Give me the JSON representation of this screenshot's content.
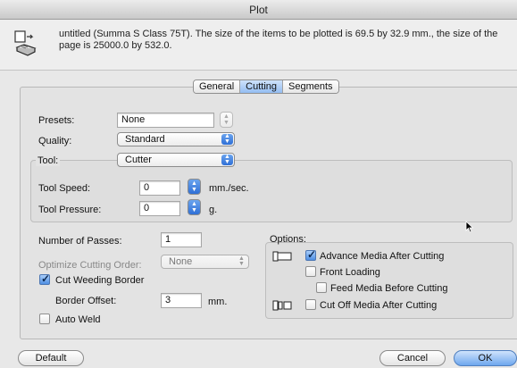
{
  "window": {
    "title": "Plot"
  },
  "info": {
    "message": "untitled (Summa S Class 75T). The size of the items to be plotted is 69.5 by 32.9 mm., the size of the page is 25000.0 by 532.0."
  },
  "tabs": [
    {
      "label": "General"
    },
    {
      "label": "Cutting"
    },
    {
      "label": "Segments"
    }
  ],
  "settings": {
    "presets_label": "Presets:",
    "presets_value": "None",
    "quality_label": "Quality:",
    "quality_value": "Standard",
    "tool_label": "Tool:",
    "tool_value": "Cutter"
  },
  "tool": {
    "speed_label": "Tool Speed:",
    "speed_value": "0",
    "speed_unit": "mm./sec.",
    "pressure_label": "Tool Pressure:",
    "pressure_value": "0",
    "pressure_unit": "g."
  },
  "passes": {
    "label": "Number of Passes:",
    "value": "1",
    "order_label": "Optimize Cutting Order:",
    "order_value": "None",
    "weeding_label": "Cut Weeding Border",
    "border_offset_label": "Border Offset:",
    "border_offset_value": "3",
    "border_offset_unit": "mm.",
    "auto_weld_label": "Auto Weld"
  },
  "options": {
    "title": "Options:",
    "advance_label": "Advance Media After Cutting",
    "front_label": "Front Loading",
    "feed_label": "Feed Media Before Cutting",
    "cutoff_label": "Cut Off Media After Cutting"
  },
  "buttons": {
    "default_label": "Default",
    "cancel_label": "Cancel",
    "ok_label": "OK"
  },
  "colors": {
    "accent": "#4f8fe3",
    "selected_tab": "#94bdf2"
  }
}
